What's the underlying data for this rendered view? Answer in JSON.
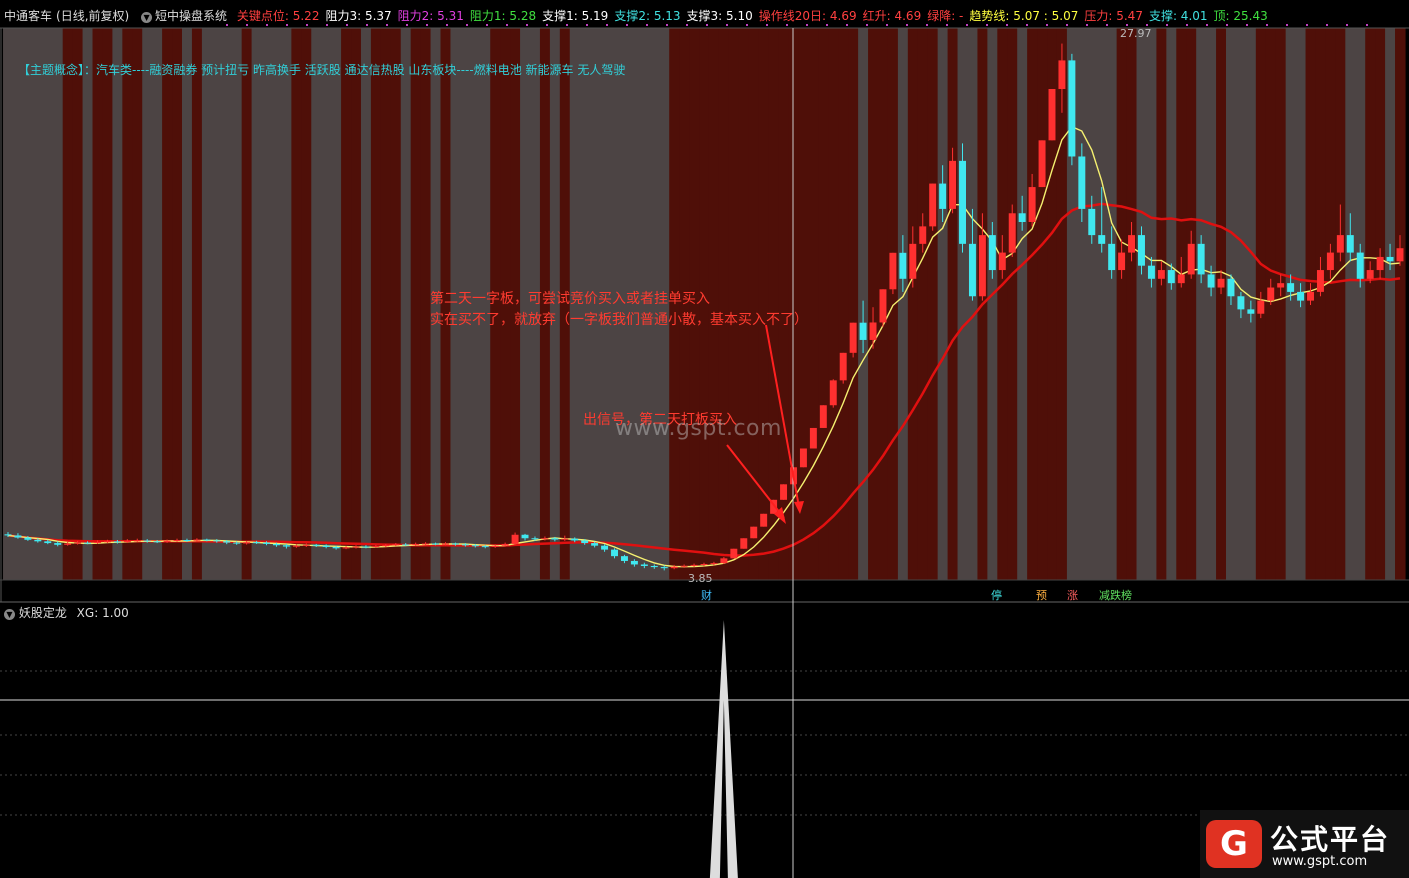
{
  "header": {
    "stock": "中通客车",
    "period": "(日线,前复权)",
    "system": "短中操盘系统",
    "items": [
      {
        "label": "关键点位:",
        "value": "5.22",
        "color": "#ff4040"
      },
      {
        "label": "阻力3:",
        "value": "5.37",
        "color": "#ffffff"
      },
      {
        "label": "阻力2:",
        "value": "5.31",
        "color": "#e040e0"
      },
      {
        "label": "阻力1:",
        "value": "5.28",
        "color": "#40e040"
      },
      {
        "label": "支撑1:",
        "value": "5.19",
        "color": "#ffffff"
      },
      {
        "label": "支撑2:",
        "value": "5.13",
        "color": "#40e0e0"
      },
      {
        "label": "支撑3:",
        "value": "5.10",
        "color": "#ffffff"
      },
      {
        "label": "操作线20日:",
        "value": "4.69",
        "color": "#ff4040"
      },
      {
        "label": "红升:",
        "value": "4.69",
        "color": "#ff4040"
      },
      {
        "label": "绿降:",
        "value": "-",
        "color": "#ff4040"
      },
      {
        "label": "趋势线:",
        "value": "5.07 : 5.07",
        "color": "#ffff40"
      },
      {
        "label": "压力:",
        "value": "5.47",
        "color": "#ff4040"
      },
      {
        "label": "支撑:",
        "value": "4.01",
        "color": "#40e0e0"
      },
      {
        "label": "顶:",
        "value": "25.43",
        "color": "#40e040"
      }
    ]
  },
  "concept": "【主题概念】：汽车类----融资融券 预计扭亏 昨高换手 活跃股 通达信热股 山东板块----燃料电池 新能源车 无人驾驶",
  "notes": {
    "note1_line1": "第二天一字板，可尝试竞价买入或者挂单买入",
    "note1_line2": "实在买不了，就放弃（一字板我们普通小散，基本买入不了）",
    "note2": "出信号，第二天打板买入"
  },
  "watermark": "www.gspt.com",
  "tags": [
    {
      "text": "财",
      "color": "#40c0ff"
    },
    {
      "text": "停",
      "color": "#40e0e0"
    },
    {
      "text": "预",
      "color": "#ffb040"
    },
    {
      "text": "涨",
      "color": "#ff6060"
    },
    {
      "text": "减跌榜",
      "color": "#60e060"
    }
  ],
  "indicator": {
    "name": "妖股定龙",
    "label": "XG:",
    "value": "1.00"
  },
  "logo": {
    "mark": "G",
    "name": "公式平台",
    "url": "www.gspt.com"
  },
  "chart_data": {
    "type": "candlestick",
    "price_high_label": "27.97",
    "price_low_label": "3.85",
    "candles": [
      [
        5.5,
        5.45,
        5.6,
        5.38
      ],
      [
        5.45,
        5.35,
        5.55,
        5.3
      ],
      [
        5.35,
        5.25,
        5.42,
        5.2
      ],
      [
        5.25,
        5.18,
        5.32,
        5.12
      ],
      [
        5.18,
        5.1,
        5.25,
        5.05
      ],
      [
        5.1,
        5.02,
        5.18,
        4.95
      ],
      [
        5.02,
        5.08,
        5.15,
        4.98
      ],
      [
        5.08,
        5.12,
        5.2,
        5.03
      ],
      [
        5.12,
        5.1,
        5.18,
        5.05
      ],
      [
        5.1,
        5.15,
        5.22,
        5.06
      ],
      [
        5.15,
        5.18,
        5.25,
        5.1
      ],
      [
        5.18,
        5.14,
        5.24,
        5.08
      ],
      [
        5.14,
        5.2,
        5.28,
        5.1
      ],
      [
        5.2,
        5.22,
        5.3,
        5.15
      ],
      [
        5.22,
        5.18,
        5.28,
        5.12
      ],
      [
        5.18,
        5.15,
        5.24,
        5.1
      ],
      [
        5.15,
        5.2,
        5.26,
        5.11
      ],
      [
        5.2,
        5.24,
        5.3,
        5.16
      ],
      [
        5.24,
        5.21,
        5.3,
        5.15
      ],
      [
        5.21,
        5.26,
        5.32,
        5.18
      ],
      [
        5.26,
        5.22,
        5.3,
        5.18
      ],
      [
        5.22,
        5.18,
        5.28,
        5.12
      ],
      [
        5.18,
        5.12,
        5.24,
        5.05
      ],
      [
        5.12,
        5.08,
        5.18,
        5.02
      ],
      [
        5.08,
        5.14,
        5.2,
        5.03
      ],
      [
        5.14,
        5.12,
        5.2,
        5.06
      ],
      [
        5.12,
        5.06,
        5.18,
        5.0
      ],
      [
        5.06,
        5.0,
        5.12,
        4.93
      ],
      [
        5.0,
        4.94,
        5.06,
        4.85
      ],
      [
        4.94,
        4.98,
        5.04,
        4.88
      ],
      [
        4.98,
        5.02,
        5.08,
        4.92
      ],
      [
        5.02,
        4.98,
        5.06,
        4.92
      ],
      [
        4.98,
        4.92,
        5.04,
        4.86
      ],
      [
        4.92,
        4.86,
        4.98,
        4.8
      ],
      [
        4.86,
        4.9,
        4.96,
        4.82
      ],
      [
        4.9,
        4.94,
        5.0,
        4.85
      ],
      [
        4.94,
        4.92,
        5.0,
        4.86
      ],
      [
        4.92,
        4.96,
        5.02,
        4.88
      ],
      [
        4.96,
        5.0,
        5.06,
        4.9
      ],
      [
        5.0,
        5.04,
        5.1,
        4.96
      ],
      [
        5.04,
        5.02,
        5.1,
        4.96
      ],
      [
        5.02,
        5.06,
        5.12,
        4.98
      ],
      [
        5.06,
        5.08,
        5.14,
        5.0
      ],
      [
        5.08,
        5.05,
        5.12,
        5.0
      ],
      [
        5.05,
        5.08,
        5.14,
        5.0
      ],
      [
        5.08,
        5.04,
        5.12,
        4.98
      ],
      [
        5.04,
        5.0,
        5.1,
        4.94
      ],
      [
        5.0,
        4.96,
        5.06,
        4.9
      ],
      [
        4.96,
        4.92,
        5.02,
        4.86
      ],
      [
        4.92,
        4.98,
        5.04,
        4.88
      ],
      [
        4.98,
        5.06,
        5.12,
        4.94
      ],
      [
        5.06,
        5.48,
        5.58,
        5.04
      ],
      [
        5.48,
        5.32,
        5.52,
        5.22
      ],
      [
        5.32,
        5.28,
        5.4,
        5.2
      ],
      [
        5.28,
        5.32,
        5.4,
        5.22
      ],
      [
        5.32,
        5.26,
        5.38,
        5.18
      ],
      [
        5.26,
        5.3,
        5.44,
        5.2
      ],
      [
        5.3,
        5.22,
        5.36,
        5.14
      ],
      [
        5.22,
        5.1,
        5.28,
        5.02
      ],
      [
        5.1,
        4.98,
        5.16,
        4.9
      ],
      [
        4.98,
        4.8,
        5.04,
        4.7
      ],
      [
        4.8,
        4.5,
        4.86,
        4.4
      ],
      [
        4.5,
        4.28,
        4.56,
        4.18
      ],
      [
        4.28,
        4.12,
        4.36,
        4.02
      ],
      [
        4.12,
        4.05,
        4.2,
        3.95
      ],
      [
        4.05,
        4.0,
        4.12,
        3.92
      ],
      [
        4.0,
        3.95,
        4.08,
        3.85
      ],
      [
        3.95,
        4.02,
        4.1,
        3.9
      ],
      [
        4.02,
        4.06,
        4.12,
        3.96
      ],
      [
        4.06,
        4.1,
        4.16,
        4.0
      ],
      [
        4.1,
        4.14,
        4.2,
        4.04
      ],
      [
        4.14,
        4.18,
        4.24,
        4.08
      ],
      [
        4.18,
        4.4,
        4.46,
        4.14
      ],
      [
        4.4,
        4.84,
        4.84,
        4.4
      ],
      [
        4.84,
        5.32,
        5.32,
        4.84
      ],
      [
        5.32,
        5.85,
        5.85,
        5.32
      ],
      [
        5.85,
        6.44,
        6.44,
        5.85
      ],
      [
        6.44,
        7.08,
        7.08,
        6.44
      ],
      [
        7.08,
        7.79,
        7.79,
        7.08
      ],
      [
        7.79,
        8.57,
        8.57,
        7.79
      ],
      [
        8.57,
        9.43,
        9.43,
        8.57
      ],
      [
        9.43,
        10.37,
        10.37,
        9.43
      ],
      [
        10.37,
        11.41,
        11.41,
        10.37
      ],
      [
        11.41,
        12.55,
        12.6,
        11.3
      ],
      [
        12.55,
        13.81,
        13.81,
        12.4
      ],
      [
        13.81,
        15.19,
        15.19,
        13.6
      ],
      [
        15.19,
        14.4,
        16.2,
        13.8
      ],
      [
        14.4,
        15.2,
        15.9,
        14.0
      ],
      [
        15.2,
        16.72,
        16.72,
        15.0
      ],
      [
        16.72,
        18.39,
        18.39,
        16.5
      ],
      [
        18.39,
        17.2,
        19.2,
        16.6
      ],
      [
        17.2,
        18.8,
        19.6,
        16.8
      ],
      [
        18.8,
        19.6,
        20.2,
        18.4
      ],
      [
        19.6,
        21.56,
        21.56,
        19.4
      ],
      [
        21.56,
        20.4,
        22.4,
        19.8
      ],
      [
        20.4,
        22.6,
        23.2,
        20.2
      ],
      [
        22.6,
        18.8,
        23.4,
        18.4
      ],
      [
        18.8,
        16.4,
        20.4,
        16.2
      ],
      [
        16.4,
        19.2,
        20.2,
        16.2
      ],
      [
        19.2,
        17.6,
        19.8,
        17.2
      ],
      [
        17.6,
        18.4,
        19.2,
        17.2
      ],
      [
        18.4,
        20.2,
        20.6,
        18.2
      ],
      [
        20.2,
        19.8,
        21.0,
        19.4
      ],
      [
        19.8,
        21.4,
        22.0,
        19.6
      ],
      [
        21.4,
        23.54,
        23.54,
        21.4
      ],
      [
        23.54,
        25.89,
        25.89,
        23.54
      ],
      [
        25.89,
        27.2,
        27.97,
        24.8
      ],
      [
        27.2,
        22.8,
        27.5,
        22.4
      ],
      [
        22.8,
        20.4,
        23.4,
        19.8
      ],
      [
        20.4,
        19.2,
        21.0,
        18.8
      ],
      [
        19.2,
        18.8,
        21.4,
        18.4
      ],
      [
        18.8,
        17.6,
        19.6,
        17.2
      ],
      [
        17.6,
        18.4,
        19.0,
        17.2
      ],
      [
        18.4,
        19.2,
        19.8,
        18.0
      ],
      [
        19.2,
        17.8,
        19.6,
        17.4
      ],
      [
        17.8,
        17.2,
        18.2,
        16.8
      ],
      [
        17.2,
        17.6,
        18.0,
        16.9
      ],
      [
        17.6,
        17.0,
        17.9,
        16.7
      ],
      [
        17.0,
        17.4,
        18.2,
        16.8
      ],
      [
        17.4,
        18.8,
        19.4,
        17.2
      ],
      [
        18.8,
        17.4,
        19.2,
        17.0
      ],
      [
        17.4,
        16.8,
        17.8,
        16.4
      ],
      [
        16.8,
        17.2,
        17.6,
        16.5
      ],
      [
        17.2,
        16.4,
        17.4,
        16.0
      ],
      [
        16.4,
        15.8,
        16.6,
        15.4
      ],
      [
        15.8,
        15.6,
        16.2,
        15.2
      ],
      [
        15.6,
        16.2,
        16.6,
        15.4
      ],
      [
        16.2,
        16.8,
        17.2,
        16.0
      ],
      [
        16.8,
        17.0,
        17.4,
        16.4
      ],
      [
        17.0,
        16.6,
        17.4,
        16.2
      ],
      [
        16.6,
        16.2,
        17.0,
        15.9
      ],
      [
        16.2,
        16.6,
        17.0,
        16.0
      ],
      [
        16.6,
        17.6,
        18.2,
        16.4
      ],
      [
        17.6,
        18.4,
        18.8,
        17.2
      ],
      [
        18.4,
        19.2,
        20.6,
        18.0
      ],
      [
        19.2,
        18.4,
        20.2,
        18.0
      ],
      [
        18.4,
        17.2,
        18.8,
        16.8
      ],
      [
        17.2,
        17.6,
        18.0,
        17.0
      ],
      [
        17.6,
        18.2,
        18.6,
        17.2
      ],
      [
        18.2,
        18.0,
        18.8,
        17.6
      ],
      [
        18.0,
        18.6,
        19.2,
        17.8
      ]
    ],
    "signal_index": 72,
    "ylim": [
      3.5,
      28.5
    ]
  }
}
